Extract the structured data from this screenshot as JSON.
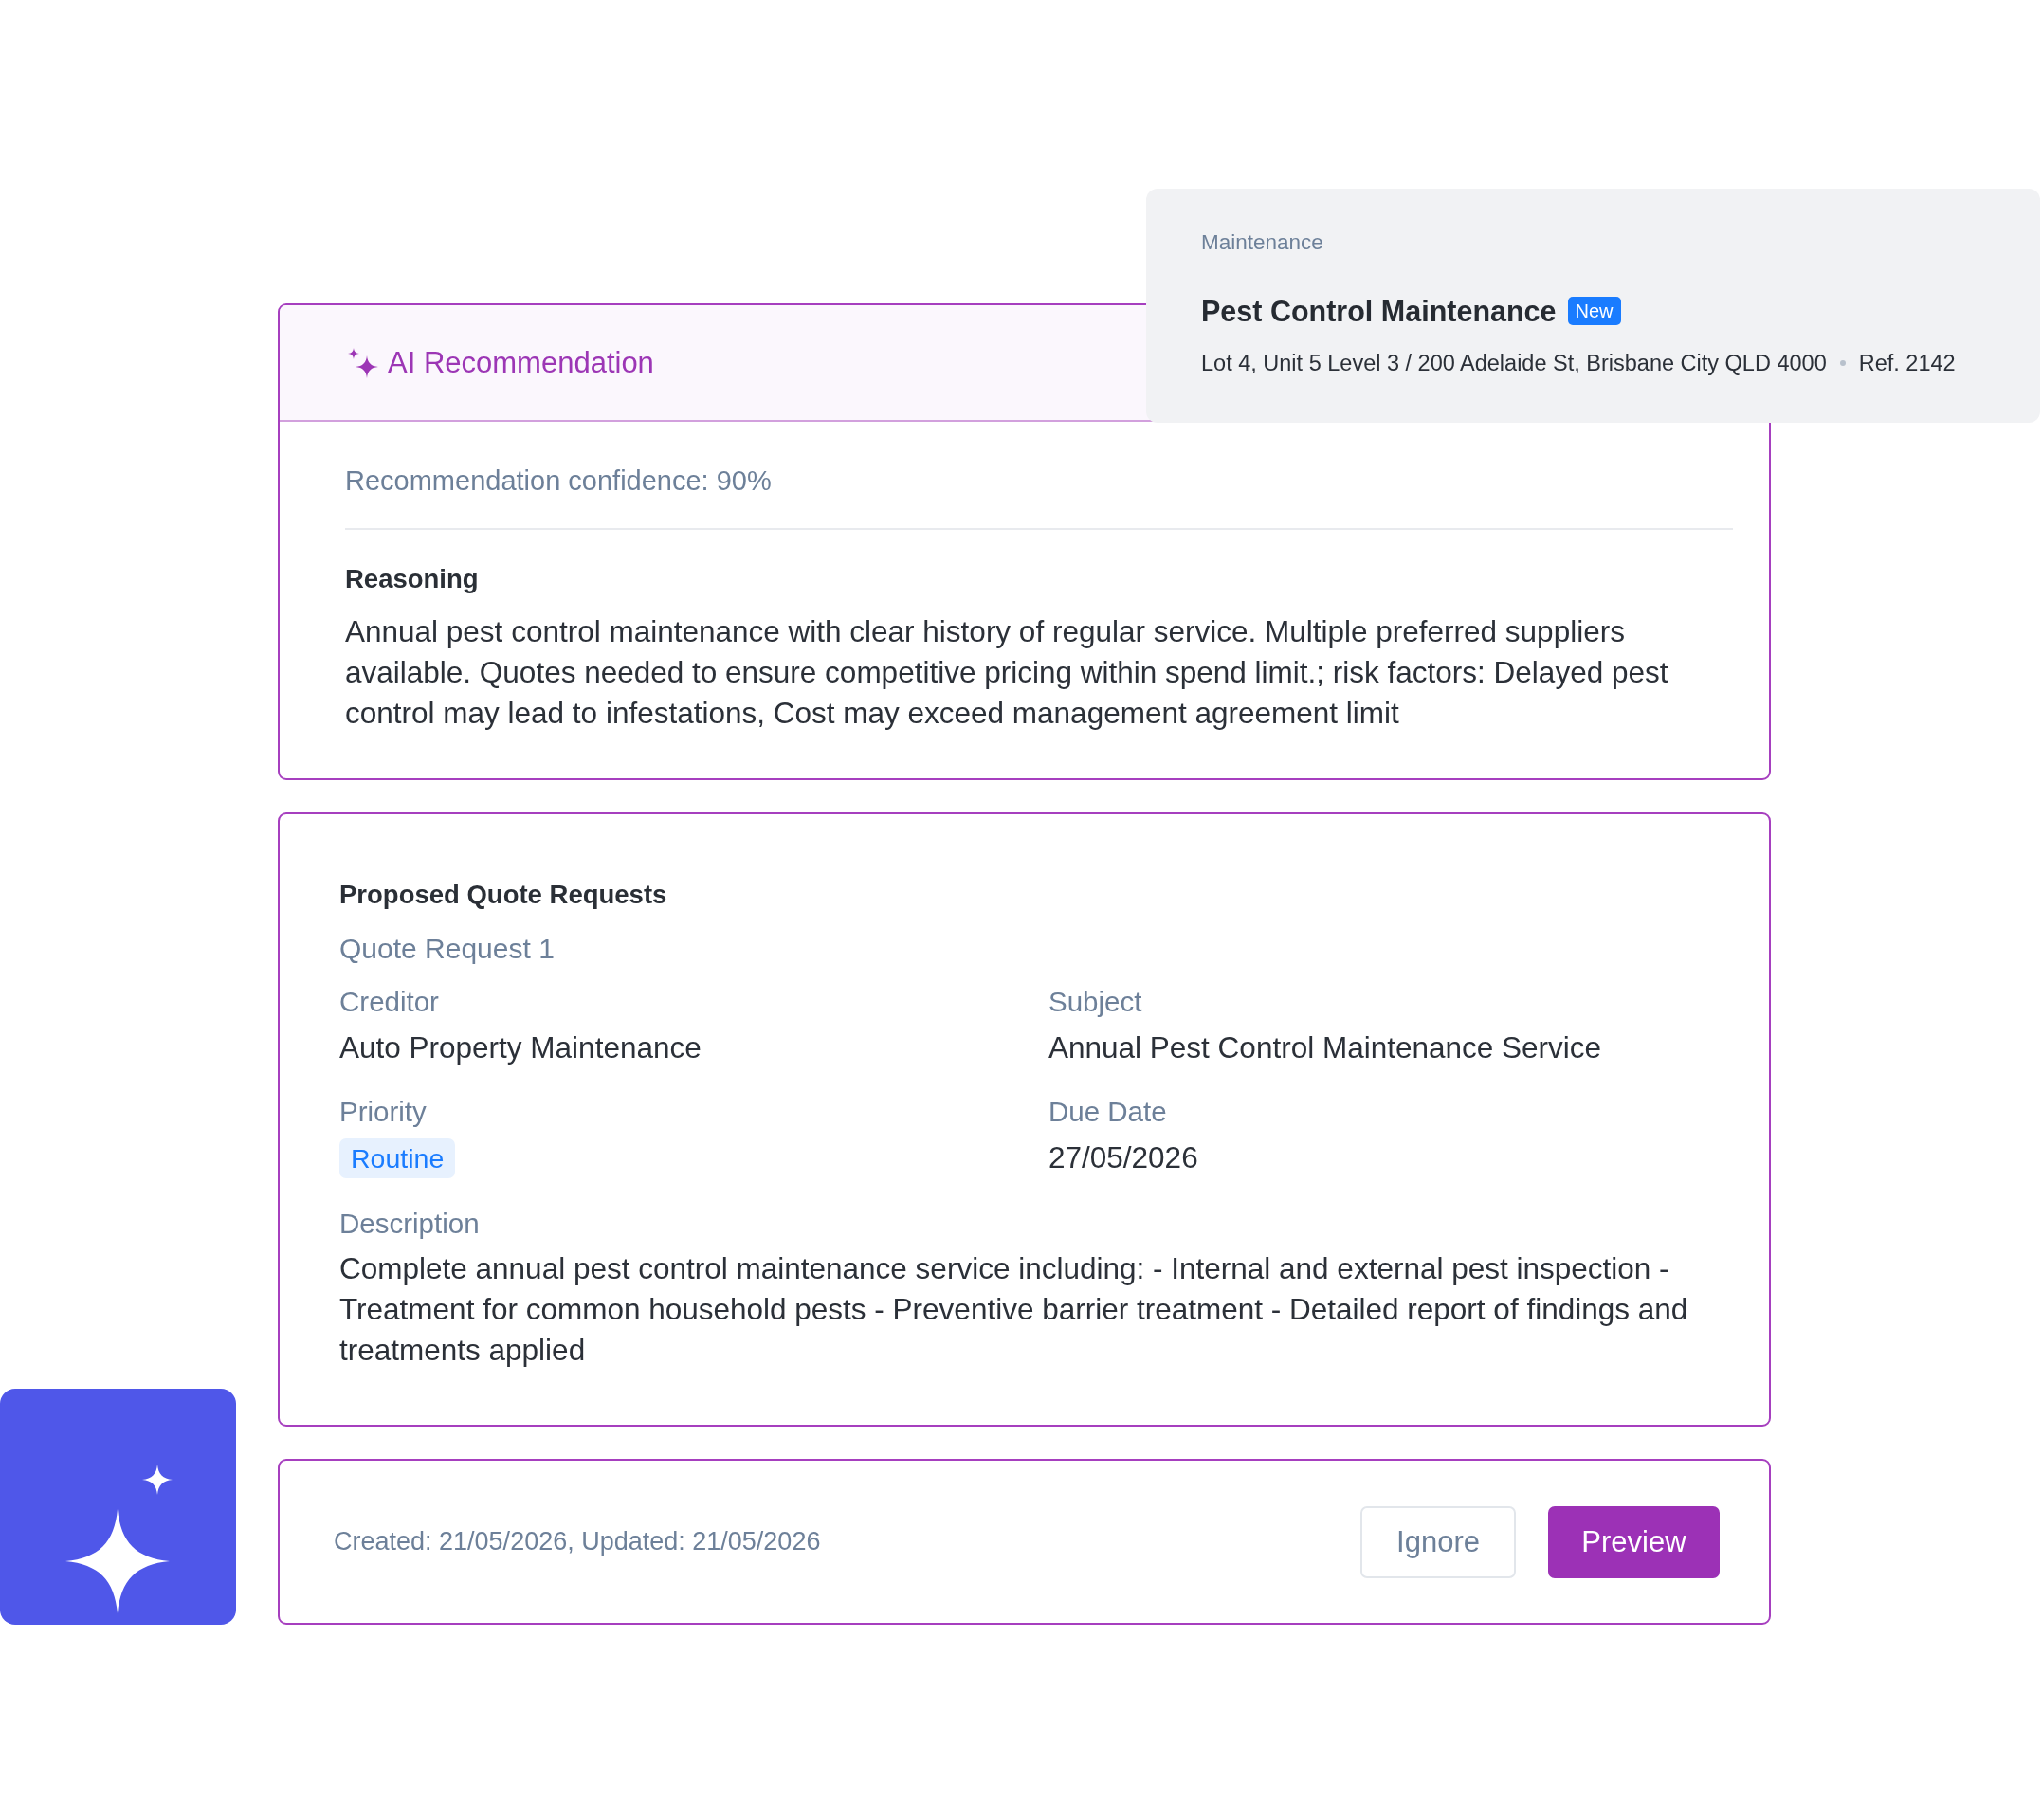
{
  "property_card": {
    "category": "Maintenance",
    "title": "Pest Control Maintenance",
    "badge": "New",
    "address": "Lot 4, Unit 5 Level 3 / 200 Adelaide St, Brisbane City QLD 4000",
    "reference": "Ref. 2142"
  },
  "recommendation": {
    "title": "AI Recommendation",
    "confidence": "Recommendation confidence: 90%",
    "reasoning_heading": "Reasoning",
    "reasoning": "Annual pest control maintenance with clear history of regular service. Multiple preferred suppliers available. Quotes needed to ensure competitive pricing within spend limit.; risk factors: Delayed pest control may lead to infestations, Cost may exceed management agreement limit"
  },
  "quote_requests": {
    "heading": "Proposed Quote Requests",
    "requests": [
      {
        "title": "Quote Request 1",
        "fields": [
          {
            "label": "Creditor",
            "value": "Auto Property Maintenance",
            "kind": "text"
          },
          {
            "label": "Subject",
            "value": "Annual Pest Control Maintenance Service",
            "kind": "text"
          },
          {
            "label": "Priority",
            "value": "Routine",
            "kind": "tag"
          },
          {
            "label": "Due Date",
            "value": "27/05/2026",
            "kind": "text"
          },
          {
            "label": "Description",
            "value": "Complete annual pest control maintenance service including: - Internal and external pest inspection - Treatment for common household pests - Preventive barrier treatment - Detailed report of findings and treatments applied",
            "kind": "paragraph"
          }
        ]
      }
    ]
  },
  "footer": {
    "timestamps": "Created: 21/05/2026, Updated: 21/05/2026",
    "buttons": [
      {
        "label": "Ignore",
        "kind": "secondary"
      },
      {
        "label": "Preview",
        "kind": "primary"
      }
    ]
  }
}
